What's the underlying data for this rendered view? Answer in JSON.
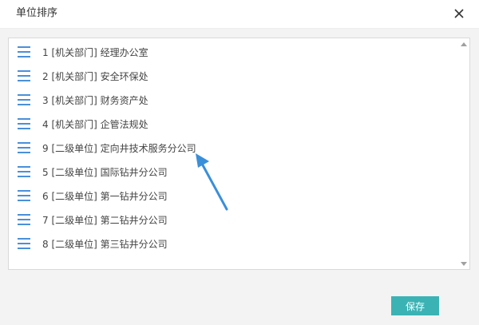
{
  "dialog": {
    "title": "单位排序",
    "close_icon": "close-icon"
  },
  "list": {
    "items": [
      {
        "label": "1 [机关部门] 经理办公室"
      },
      {
        "label": "2 [机关部门] 安全环保处"
      },
      {
        "label": "3 [机关部门] 财务资产处"
      },
      {
        "label": "4 [机关部门] 企管法规处"
      },
      {
        "label": "9 [二级单位] 定向井技术服务分公司"
      },
      {
        "label": "5 [二级单位] 国际钻井分公司"
      },
      {
        "label": "6 [二级单位] 第一钻井分公司"
      },
      {
        "label": "7 [二级单位] 第二钻井分公司"
      },
      {
        "label": "8 [二级单位] 第三钻井分公司"
      }
    ],
    "handle_icon": "drag-handle-icon"
  },
  "footer": {
    "save_label": "保存"
  },
  "colors": {
    "accent": "#3bb3b5",
    "handle": "#4a90d9",
    "annotation_arrow": "#3a8fd9"
  }
}
